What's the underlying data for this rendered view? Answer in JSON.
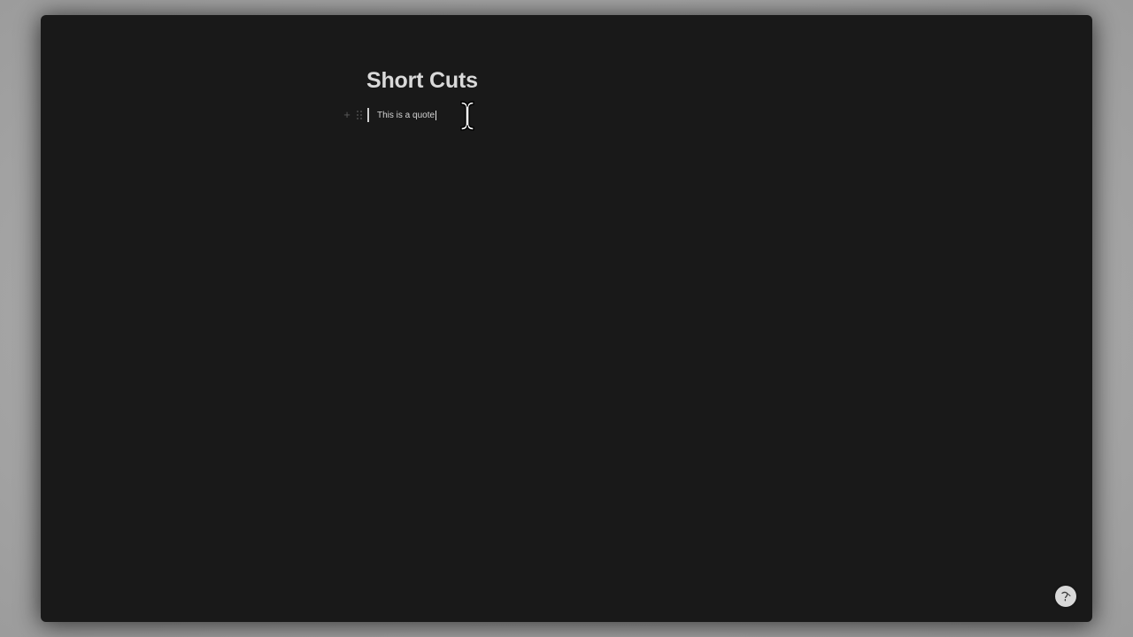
{
  "page": {
    "title": "Short Cuts"
  },
  "blocks": [
    {
      "type": "quote",
      "text": "This is a quote",
      "focused": true
    }
  ],
  "icons": {
    "add_block": "plus-icon",
    "drag_block": "drag-handle-icon",
    "cursor": "text-cursor-icon",
    "help": "help-icon"
  },
  "colors": {
    "window_background": "#191919",
    "desktop_background": "#a8a8a8",
    "title_text": "#d9d9d9",
    "body_text": "#d4d4d4",
    "quote_bar": "#cfcfcf"
  }
}
